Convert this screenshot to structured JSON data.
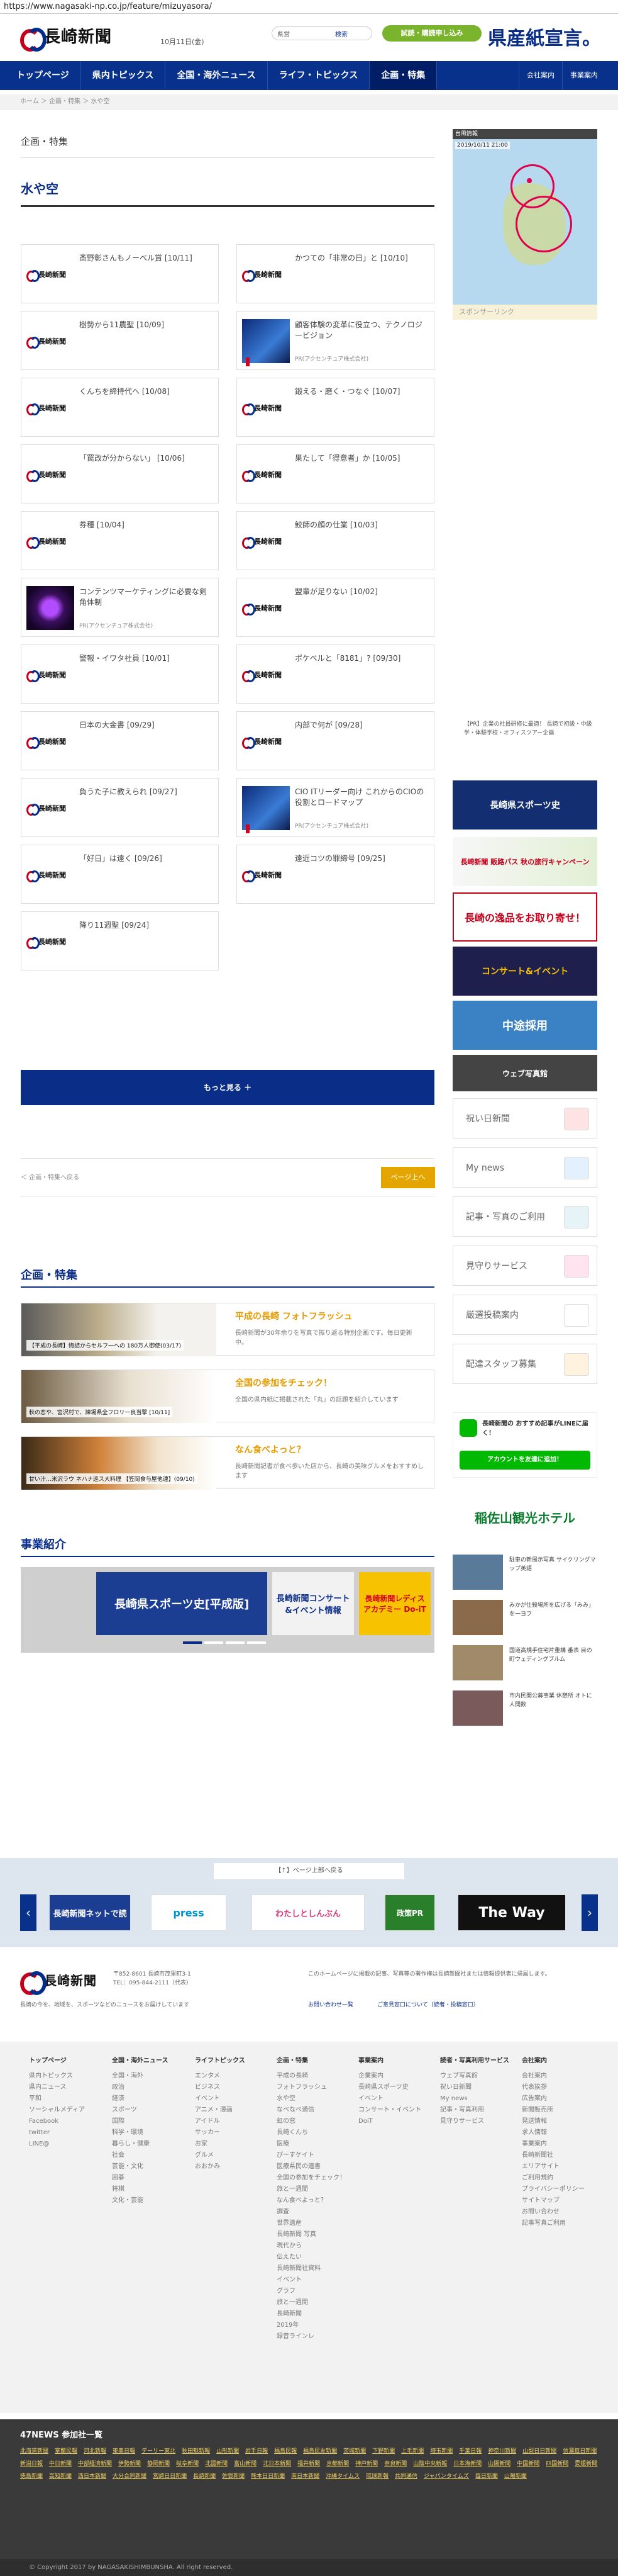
{
  "browser": {
    "url": "https://www.nagasaki-np.co.jp/feature/mizuyasora/"
  },
  "header": {
    "logo": "長崎新聞",
    "date": "10月11日(金)",
    "search_label": "検索",
    "search_placeholder": "",
    "weather_label": "県営",
    "trial_button": "試読・購読申し込み",
    "slogan": "県産紙宣言。",
    "nav": [
      "トップページ",
      "県内トピックス",
      "全国・海外ニュース",
      "ライフ・トピックス",
      "企画・特集"
    ],
    "nav_small": [
      "会社案内",
      "事業案内"
    ]
  },
  "breadcrumb": "ホーム ＞ 企画・特集 ＞ 水や空",
  "page": {
    "section": "企画・特集",
    "title": "水や空",
    "cards": [
      {
        "title": "斎野彰さんもノーベル賞 [10/11]",
        "sub": "",
        "type": "logo"
      },
      {
        "title": "かつての「非常の日」と [10/10]",
        "sub": "",
        "type": "logo"
      },
      {
        "title": "樹勢から11農聖 [10/09]",
        "sub": "",
        "type": "logo"
      },
      {
        "title": "顧客体験の変革に役立つ、テクノロジービジョン",
        "sub": "PR(アクセンチュア株式会社)",
        "type": "blue"
      },
      {
        "title": "くんちを締持代へ [10/08]",
        "sub": "",
        "type": "logo"
      },
      {
        "title": "鍛える・磨く・つなぐ [10/07]",
        "sub": "",
        "type": "logo"
      },
      {
        "title": "「罠改が分からない」 [10/06]",
        "sub": "",
        "type": "logo"
      },
      {
        "title": "果たして「得意者」か [10/05]",
        "sub": "",
        "type": "logo"
      },
      {
        "title": "券種 [10/04]",
        "sub": "",
        "type": "logo"
      },
      {
        "title": "鮫師の顔の仕業 [10/03]",
        "sub": "",
        "type": "logo"
      },
      {
        "title": "コンテンツマーケティングに必要な剣角体制",
        "sub": "PR(アクセンチュア株式会社)",
        "type": "purple"
      },
      {
        "title": "盟輩が足りない [10/02]",
        "sub": "",
        "type": "logo"
      },
      {
        "title": "警報・イワタ社員 [10/01]",
        "sub": "",
        "type": "logo"
      },
      {
        "title": "ポケベルと「8181」? [09/30]",
        "sub": "",
        "type": "logo"
      },
      {
        "title": "日本の大金書 [09/29]",
        "sub": "",
        "type": "logo"
      },
      {
        "title": "内部で何が [09/28]",
        "sub": "",
        "type": "logo"
      },
      {
        "title": "負うた子に教えられ [09/27]",
        "sub": "",
        "type": "logo"
      },
      {
        "title": "CIO ITリーダー向け これからのCIOの役割とロードマップ",
        "sub": "PR(アクセンチュア株式会社)",
        "type": "blue"
      },
      {
        "title": "「好日」は遠く [09/26]",
        "sub": "",
        "type": "logo"
      },
      {
        "title": "遠近コツの罪締号 [09/25]",
        "sub": "",
        "type": "logo"
      },
      {
        "title": "降り11週聖 [09/24]",
        "sub": "",
        "type": "logo"
      }
    ],
    "more_button": "もっと見る ＋",
    "back_link": "＜ 企画・特集へ戻る",
    "page_top": "ページ上へ"
  },
  "features": {
    "title": "企画・特集",
    "items": [
      {
        "title": "平成の長崎 フォトフラッシュ",
        "desc": "長崎新聞が30年余りを写真で振り返る特別企画です。毎日更新中。",
        "label": "【平成の長崎】悔詰からセルフ一への 180万人御使(03/17)"
      },
      {
        "title": "全国の参加をチェック！",
        "desc": "全国の県内紙に掲載された「丸」の話題を紹介しています",
        "label": "秋の恋や、宮沢村で、諫場県全フロリ一良当撃 [10/11]"
      },
      {
        "title": "なん食べよっと？",
        "desc": "長崎新聞記者が食べ歩いた店から、長崎の美味グルメをおすすめします",
        "label": "甘い汁…米沢ラウ ネハナ巡ス大料理 【笠岡食与屋他連】(09/10)"
      }
    ]
  },
  "business": {
    "title": "事業紹介",
    "banners": [
      "長崎県スポーツ史[平成版]",
      "長崎新聞コンサート&イベント情報",
      "長崎新聞レディスアカデミー Do-iT"
    ]
  },
  "sidebar": {
    "weather_title": "台風情報",
    "weather_time": "2019/10/11 21:00",
    "sponsor": "スポンサーリンク",
    "notice": "【PR】企業の社員研修に最適！ 長崎で初級・中級学・体験学校・オフィスツアー企画",
    "banners": [
      "長崎県スポーツ史",
      "長崎新聞 販路パス 秋の旅行キャンペーン",
      "長崎の逸品をお取り寄せ！",
      "コンサート&イベント",
      "中途採用",
      "ウェブ写真館"
    ],
    "menu": [
      "祝い日新聞",
      "My news",
      "記事・写真のご利用",
      "見守りサービス",
      "厳選投稿案内",
      "配達スタッフ募集"
    ],
    "line_title": "長崎新聞の おすすめ記事がLINEに届く！",
    "line_button": "アカウントを友達に追加！",
    "hotel": "稲佐山観光ホテル",
    "ranking": [
      "駐車の新展示写真 サイクリングマップ英語",
      "みかが仕殺場所を広げる「みみ」を一ヨフ",
      "国道高規手住宅片重構 番表 目の町ウェディングブルム",
      "市内民間公募事業 休憩所 オトに人間数"
    ]
  },
  "footer": {
    "return_top": "【↑】ページ上部へ戻る",
    "partners": [
      "長崎新聞ネットで読",
      "press",
      "わたしとしんぶん",
      "政策PR",
      "The Way"
    ],
    "address": "〒852-8601 長崎市茂里町3-1",
    "tel": "TEL：095-844-2111（代表）",
    "tagline": "長崎の今を、地域を、スポーツなどのニュースをお届けしています",
    "notice": "このホームページに掲載の記事、写真等の著作権は長崎新聞社または情報提供者に帰属します。",
    "policy_links": [
      "お問い合わせ一覧",
      "ご意見窓口について（読者・投稿窓口）"
    ],
    "columns": [
      {
        "title": "トップページ",
        "items": [
          "県内トピックス",
          "県内ニュース",
          "平和",
          "ソーシャルメディア",
          "Facebook",
          "twitter",
          "LINE@"
        ]
      },
      {
        "title": "全国・海外ニュース",
        "items": [
          "全国・海外",
          "政治",
          "経済",
          "スポーツ",
          "国際",
          "科学・環境",
          "暮らし・健康",
          "社会",
          "芸能・文化",
          "囲碁",
          "将棋",
          "文化・芸能"
        ]
      },
      {
        "title": "ライフトピックス",
        "items": [
          "エンタメ",
          "ビジネス",
          "イベント",
          "アニメ・漫画",
          "アイドル",
          "サッカー",
          "お家",
          "グルメ",
          "おおかみ"
        ]
      },
      {
        "title": "企画・特集",
        "items": [
          "平成の長崎",
          "フォトフラッシュ",
          "水や空",
          "なべなべ通信",
          "虹の窓",
          "長崎くんち",
          "医療",
          "ぴーすケイト",
          "医療県民の遺書",
          "全国の参加をチェック！",
          "旅と一週間",
          "なん食べよっと？",
          "調査",
          "世界遺産",
          "長崎新聞 写真",
          "現代から",
          "伝えたい",
          "長崎新聞社資料",
          "イベント",
          "グラフ",
          "旅と一週間",
          "長崎新聞",
          "2019年",
          "録音ラインレ"
        ]
      },
      {
        "title": "事業案内",
        "items": [
          "企業案内",
          "長崎県スポーツ史",
          "イベント",
          "コンサート・イベント",
          "DoiT"
        ]
      },
      {
        "title": "読者・写真利用サービス",
        "items": [
          "ウェブ写真館",
          "祝い日新聞",
          "My news",
          "記事・写真利用",
          "見守りサービス"
        ]
      },
      {
        "title": "会社案内",
        "items": [
          "会社案内",
          "代表挨拶",
          "広告案内",
          "新聞販売所",
          "発送情報",
          "求人情報",
          "事業案内",
          "長崎新聞社",
          "エリアサイト",
          "ご利用規約",
          "プライバシーポリシー",
          "サイトマップ",
          "お問い合わせ",
          "記事写真ご利用"
        ]
      }
    ]
  },
  "network": {
    "title": "47NEWS 参加社一覧",
    "papers": [
      "北海道新聞",
      "室蘭民報",
      "河北新報",
      "東奥日報",
      "デーリー東北",
      "秋田魁新報",
      "山形新聞",
      "岩手日報",
      "福島民報",
      "福島民友新聞",
      "茨城新聞",
      "下野新聞",
      "上毛新聞",
      "埼玉新聞",
      "千葉日報",
      "神奈川新聞",
      "山梨日日新聞",
      "信濃毎日新聞",
      "新潟日報",
      "中日新聞",
      "中部経済新聞",
      "伊勢新聞",
      "静岡新聞",
      "岐阜新聞",
      "北國新聞",
      "富山新聞",
      "北日本新聞",
      "福井新聞",
      "京都新聞",
      "神戸新聞",
      "奈良新聞",
      "山陰中央新報",
      "日本海新聞",
      "山陽新聞",
      "中国新聞",
      "四国新聞",
      "愛媛新聞",
      "徳島新聞",
      "高知新聞",
      "西日本新聞",
      "大分合同新聞",
      "宮崎日日新聞",
      "長崎新聞",
      "佐賀新聞",
      "熊本日日新聞",
      "南日本新聞",
      "沖縄タイムス",
      "琉球新報",
      "共同通信",
      "ジャパンタイムズ",
      "毎日新聞",
      "山陽新聞"
    ]
  },
  "copyright": "© Copyright 2017 by NAGASAKISHIMBUNSHA. All right reserved.",
  "colors": {
    "brand_blue": "#08318b",
    "brand_red": "#c4001b",
    "accent_yellow": "#e5a500",
    "line_green": "#00b900"
  }
}
